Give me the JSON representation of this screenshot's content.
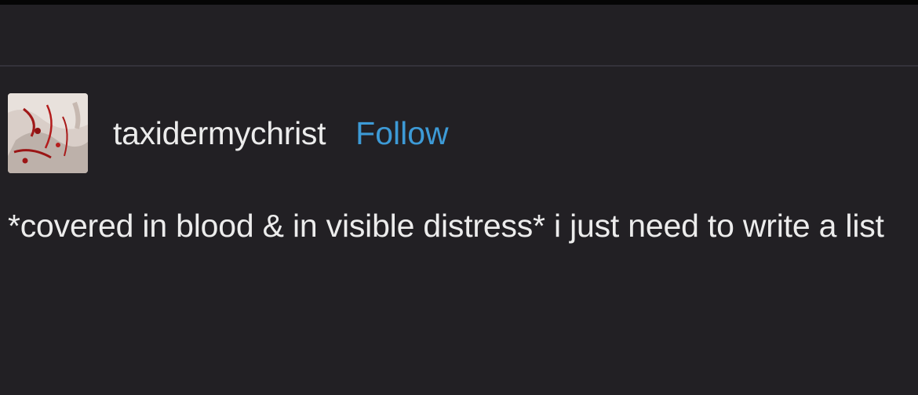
{
  "post": {
    "username": "taxidermychrist",
    "follow_label": "Follow",
    "text": "*covered in blood & in visible distress* i just need to write a list"
  },
  "colors": {
    "background": "#222024",
    "text": "#ececec",
    "follow_link": "#3d9ad6",
    "divider": "#34323a"
  }
}
